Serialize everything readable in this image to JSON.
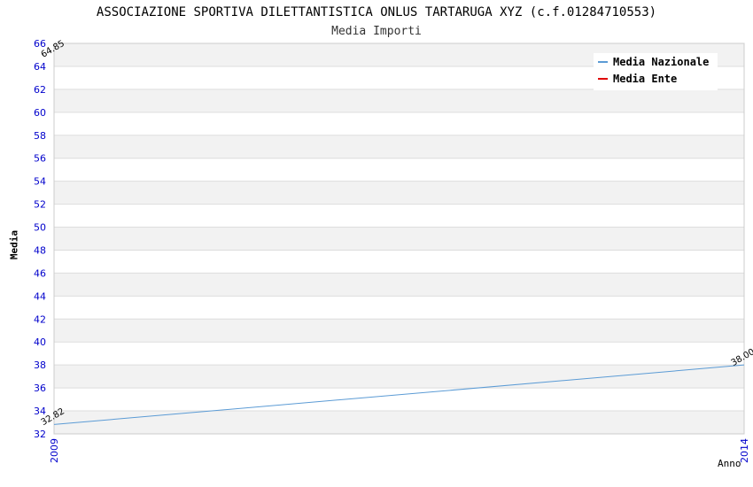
{
  "chart_data": {
    "type": "line",
    "title": "ASSOCIAZIONE SPORTIVA DILETTANTISTICA ONLUS TARTARUGA XYZ (c.f.01284710553)",
    "subtitle": "Media Importi",
    "xlabel": "Anno",
    "ylabel": "Media",
    "x": [
      2009,
      2014
    ],
    "xlim": [
      2009,
      2014
    ],
    "ylim": [
      32,
      66
    ],
    "yticks": [
      32,
      34,
      36,
      38,
      40,
      42,
      44,
      46,
      48,
      50,
      52,
      54,
      56,
      58,
      60,
      62,
      64,
      66
    ],
    "xticks": [
      "2009",
      "2014"
    ],
    "grid": true,
    "legend_position": "top-right",
    "series": [
      {
        "name": "Media Nazionale",
        "color": "#5b9bd5",
        "values": [
          32.82,
          38.0
        ],
        "labels": [
          "32.82",
          "38.00"
        ]
      },
      {
        "name": "Media Ente",
        "color": "#e00000",
        "values": [
          64.85,
          null
        ],
        "labels": [
          "64.85",
          ""
        ]
      }
    ],
    "colors": {
      "tick_label": "#0000cc",
      "band": "#f2f2f2",
      "gridline": "#dddddd"
    }
  }
}
